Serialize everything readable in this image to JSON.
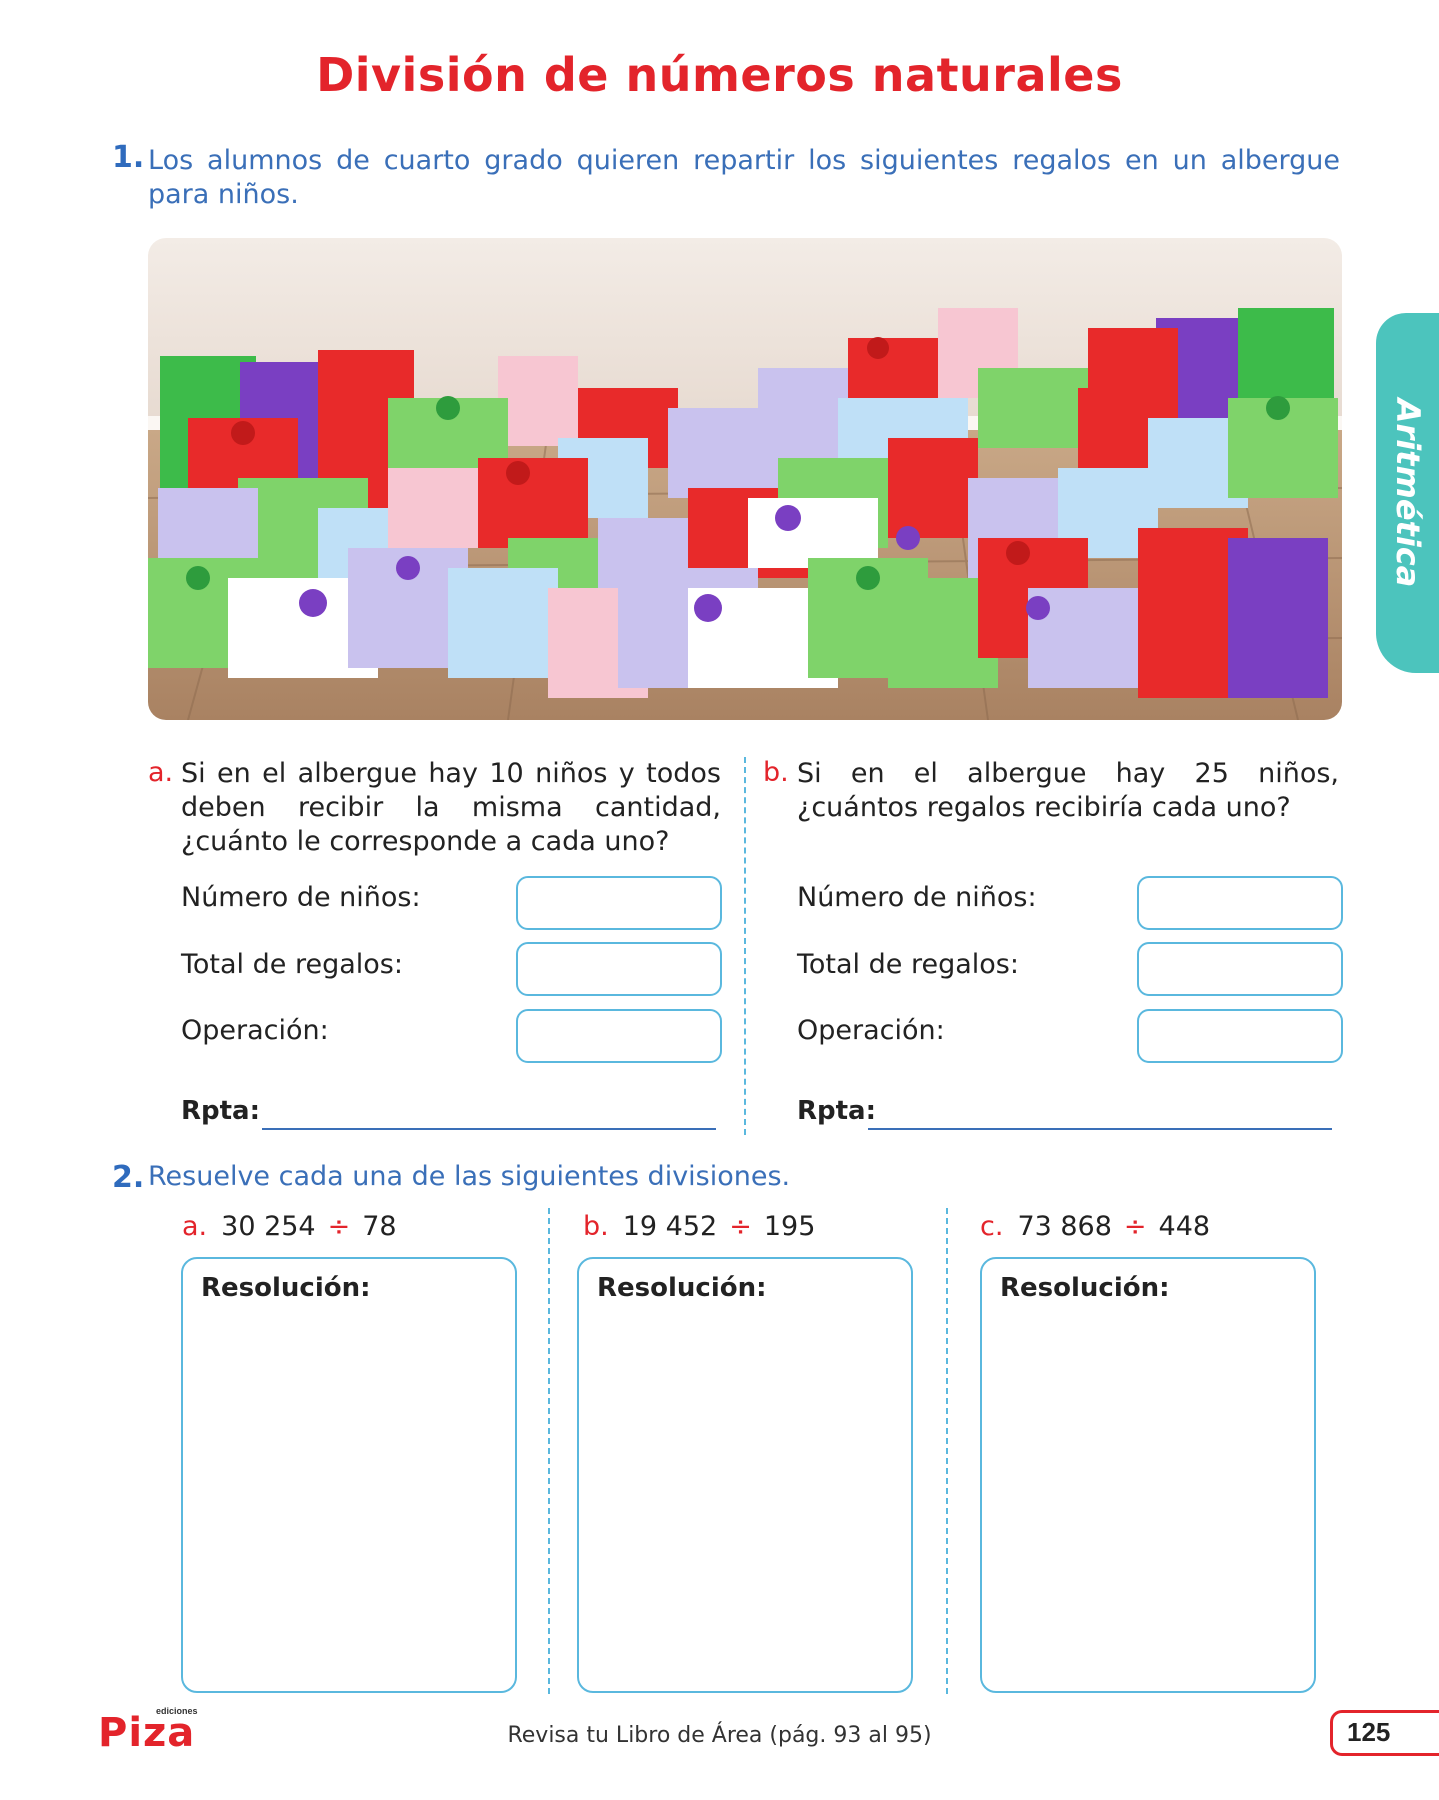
{
  "title": "División de números naturales",
  "side_tab": "Aritmética",
  "q1": {
    "number": "1.",
    "text": "Los alumnos de cuarto grado quieren repartir los siguientes regalos en un albergue para niños.",
    "a": {
      "letter": "a.",
      "question": "Si en el albergue hay 10 niños y todos deben recibir la misma cantidad, ¿cuánto le corresponde a cada uno?",
      "field1": "Número de niños:",
      "field2": "Total de regalos:",
      "field3": "Operación:",
      "rpta": "Rpta:"
    },
    "b": {
      "letter": "b.",
      "question": "Si en el albergue hay 25 niños, ¿cuántos regalos recibiría cada uno?",
      "field1": "Número de niños:",
      "field2": "Total de regalos:",
      "field3": "Operación:",
      "rpta": "Rpta:"
    }
  },
  "q2": {
    "number": "2.",
    "text": "Resuelve cada una de las siguientes divisiones.",
    "items": [
      {
        "letter": "a.",
        "dividend": "30 254",
        "op": "÷",
        "divisor": "78",
        "label": "Resolución:"
      },
      {
        "letter": "b.",
        "dividend": "19 452",
        "op": "÷",
        "divisor": "195",
        "label": "Resolución:"
      },
      {
        "letter": "c.",
        "dividend": "73 868",
        "op": "÷",
        "divisor": "448",
        "label": "Resolución:"
      }
    ]
  },
  "footer": "Revisa tu Libro de Área (pág. 93 al 95)",
  "page_number": "125",
  "logo": {
    "top": "ediciones",
    "main": "Piza"
  },
  "colors": {
    "title_red": "#e3242b",
    "blue_text": "#3a6fb8",
    "teal_tab": "#4cc4bd",
    "box_border": "#5ab8de"
  }
}
